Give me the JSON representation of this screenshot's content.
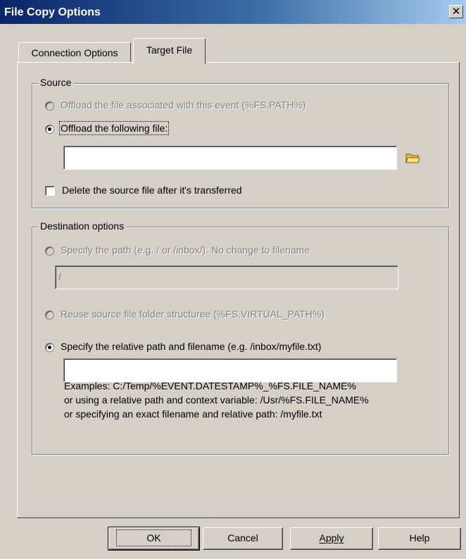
{
  "window": {
    "title": "File Copy Options",
    "close_glyph": "✕"
  },
  "tabs": [
    {
      "label": "Connection Options",
      "selected": false
    },
    {
      "label": "Target File",
      "selected": true
    }
  ],
  "source": {
    "legend": "Source",
    "option_associated": {
      "label": "Offload the file associated with this event (%FS.PATH%)",
      "checked": false,
      "enabled": false
    },
    "option_following": {
      "label": "Offload the following file:",
      "checked": true,
      "enabled": true
    },
    "file_value": "",
    "browse_icon": "folder-icon",
    "delete_checkbox": {
      "label": "Delete the source file after it's transferred",
      "checked": false
    }
  },
  "destination": {
    "legend": "Destination options",
    "option_path": {
      "label": "Specify the path (e.g. / or /inbox/). No change to filename",
      "checked": false,
      "enabled": false
    },
    "path_value": "/",
    "option_reuse": {
      "label": "Reuse source file folder structuree (%FS.VIRTUAL_PATH%)",
      "checked": false,
      "enabled": false
    },
    "option_relative": {
      "label": "Specify the relative path and filename (e.g. /inbox/myfile.txt)",
      "checked": true,
      "enabled": true
    },
    "relative_value": "",
    "examples": [
      "Examples: C:/Temp/%EVENT.DATESTAMP%_%FS.FILE_NAME%",
      "or using a relative path and context variable: /Usr/%FS.FILE_NAME%",
      "or specifying an exact filename and relative path: /myfile.txt"
    ]
  },
  "buttons": {
    "ok": "OK",
    "cancel": "Cancel",
    "apply": "Apply",
    "help": "Help"
  },
  "colors": {
    "face": "#d4d0c8",
    "title_start": "#0a246a",
    "title_end": "#a6caf0",
    "folder": "#e8c040"
  }
}
